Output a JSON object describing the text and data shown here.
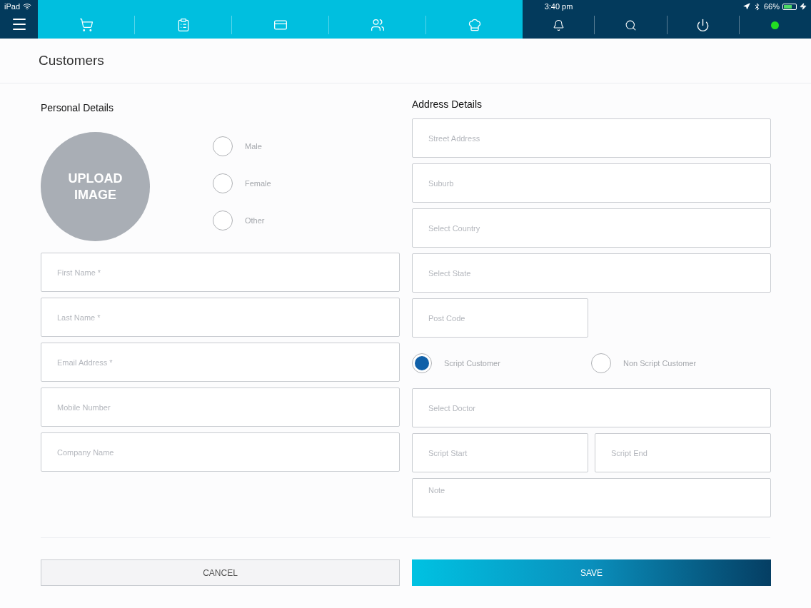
{
  "status_bar": {
    "device": "iPad",
    "time": "3:40 pm",
    "battery": "66%"
  },
  "nav": {
    "tabs": [
      {
        "kind": "cart"
      },
      {
        "kind": "tablet"
      },
      {
        "kind": "card"
      },
      {
        "kind": "people"
      },
      {
        "kind": "chef"
      }
    ],
    "online": true
  },
  "page": {
    "title": "Customers"
  },
  "personal": {
    "heading": "Personal Details",
    "upload": "UPLOAD IMAGE",
    "genders": [
      {
        "label": "Male",
        "selected": false
      },
      {
        "label": "Female",
        "selected": false
      },
      {
        "label": "Other",
        "selected": false
      }
    ],
    "fields": [
      {
        "placeholder": "First Name *"
      },
      {
        "placeholder": "Last Name *"
      },
      {
        "placeholder": "Email Address *"
      },
      {
        "placeholder": "Mobile Number"
      },
      {
        "placeholder": "Company Name"
      }
    ]
  },
  "address": {
    "heading": "Address Details",
    "rows": [
      {
        "kind": "fields",
        "fields": [
          {
            "placeholder": "Street Address",
            "kind": "full"
          }
        ]
      },
      {
        "kind": "fields",
        "fields": [
          {
            "placeholder": "Suburb",
            "kind": "full"
          }
        ]
      },
      {
        "kind": "fields",
        "fields": [
          {
            "placeholder": "Select Country",
            "kind": "full"
          }
        ]
      },
      {
        "kind": "fields",
        "fields": [
          {
            "placeholder": "Select State",
            "kind": "full"
          }
        ]
      },
      {
        "kind": "fields",
        "fields": [
          {
            "placeholder": "Post Code",
            "kind": "half"
          }
        ]
      },
      {
        "kind": "radios",
        "options": [
          {
            "label": "Script Customer",
            "selected": true
          },
          {
            "label": "Non Script Customer",
            "selected": false
          }
        ]
      },
      {
        "kind": "fields",
        "fields": [
          {
            "placeholder": "Select Doctor",
            "kind": "full"
          }
        ]
      },
      {
        "kind": "fields",
        "fields": [
          {
            "placeholder": "Script Start",
            "kind": "half"
          },
          {
            "placeholder": "Script End",
            "kind": "half"
          }
        ]
      },
      {
        "kind": "fields",
        "fields": [
          {
            "placeholder": "Note",
            "kind": "note"
          }
        ]
      }
    ]
  },
  "buttons": {
    "cancel": "CANCEL",
    "save": "SAVE"
  }
}
